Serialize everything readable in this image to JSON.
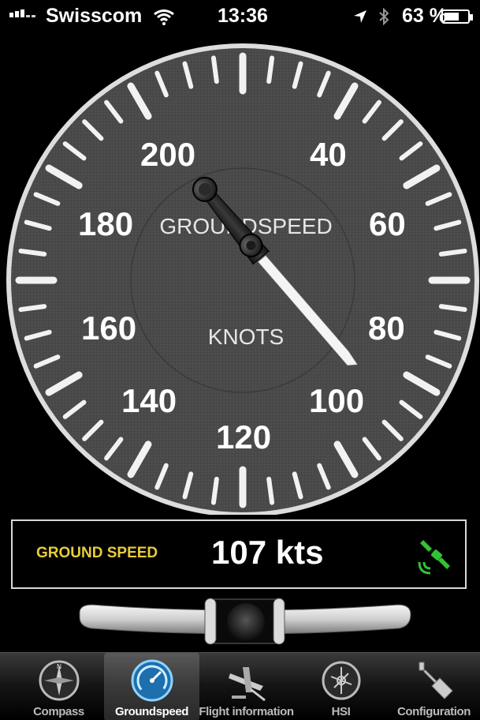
{
  "status": {
    "carrier": "Swisscom",
    "time": "13:36",
    "battery": "63 %",
    "battery_level": 0.63
  },
  "gauge": {
    "title": "GROUNDSPEED",
    "unit": "KNOTS",
    "scale_labels": [
      "200",
      "40",
      "180",
      "60",
      "160",
      "80",
      "140",
      "100",
      "120"
    ],
    "max_value": 240,
    "needle_value": 107
  },
  "readout": {
    "label": "GROUND SPEED",
    "value": "107 kts",
    "label_color": "#e8cd3a",
    "icon": "gps-satellite-icon",
    "icon_color": "#33c233"
  },
  "tabs": [
    {
      "label": "Compass",
      "icon": "compass-icon",
      "selected": false
    },
    {
      "label": "Groundspeed",
      "icon": "speedometer-icon",
      "selected": true
    },
    {
      "label": "Flight information",
      "icon": "airplane-icon",
      "selected": false
    },
    {
      "label": "HSI",
      "icon": "hsi-icon",
      "selected": false
    },
    {
      "label": "Configuration",
      "icon": "wrench-icon",
      "selected": false
    }
  ]
}
